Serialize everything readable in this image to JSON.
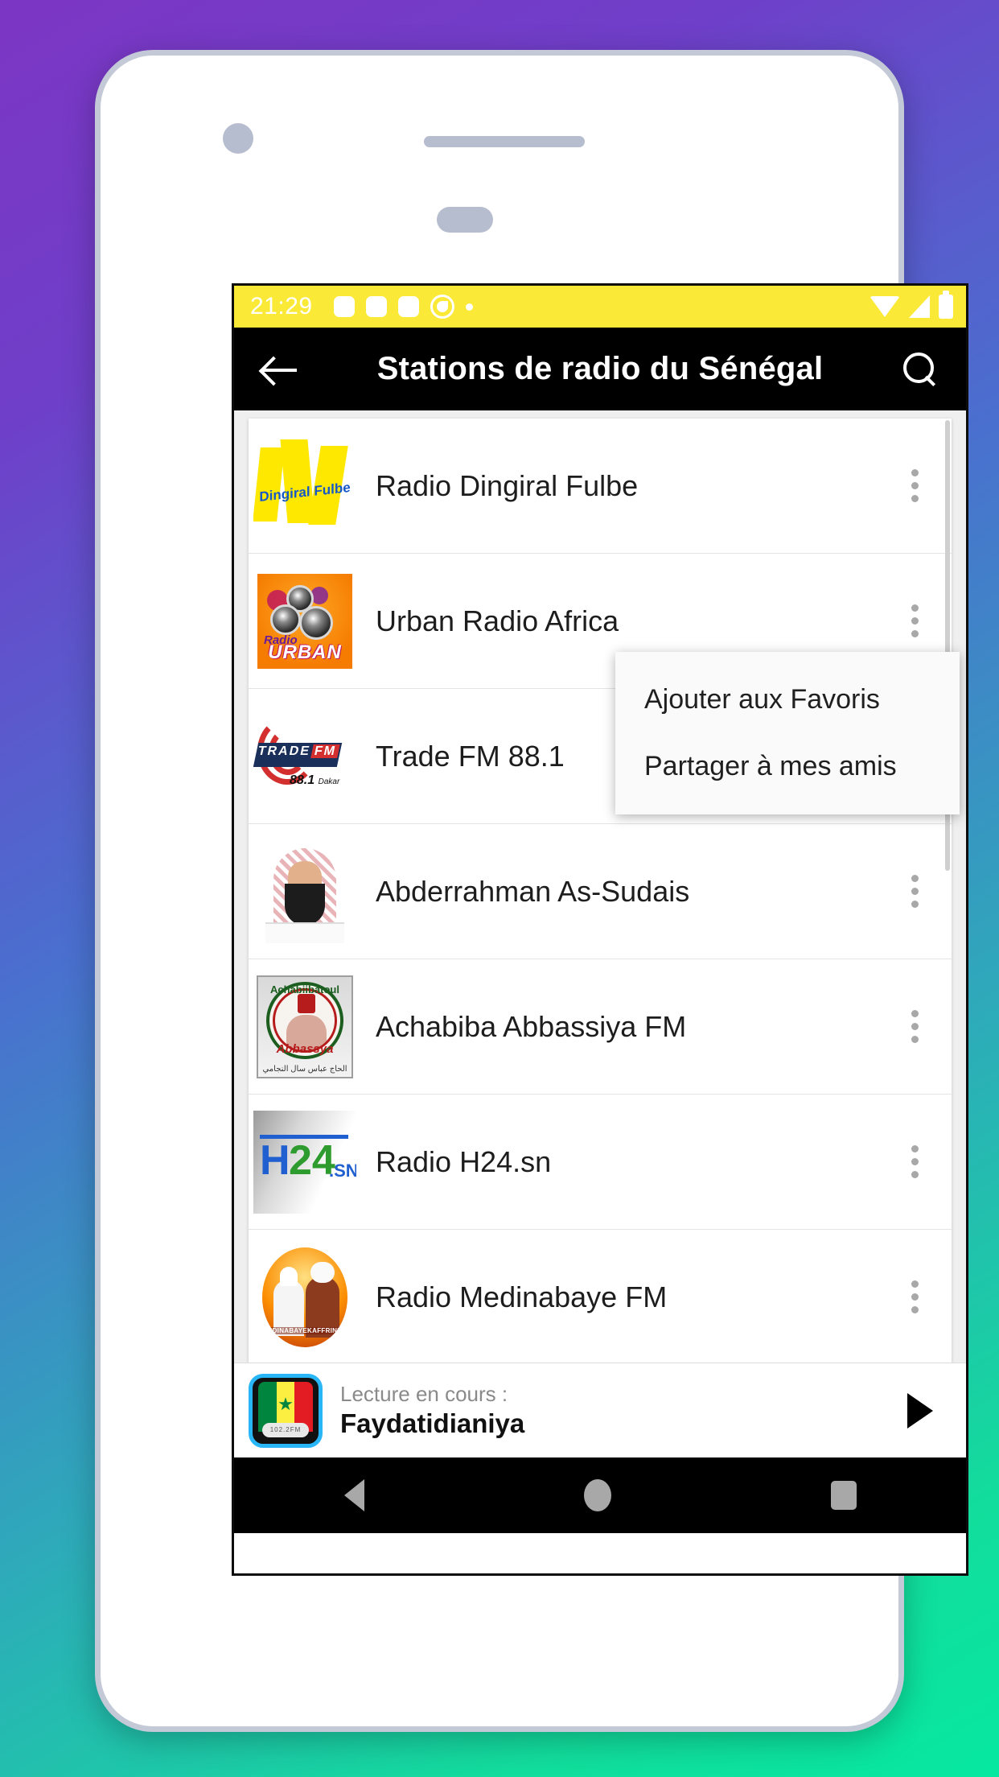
{
  "device": {
    "status_bar": {
      "time": "21:29",
      "left_icons": [
        "notification-square",
        "notification-square",
        "notification-square",
        "sync-ring-icon",
        "notification-dot"
      ],
      "right_icons": [
        "wifi-icon",
        "cell-signal-icon",
        "battery-icon"
      ],
      "background_color": "#fbe937"
    },
    "nav_bar": {
      "back": "nav-back-icon",
      "home": "nav-home-icon",
      "recents": "nav-recents-icon"
    }
  },
  "app_bar": {
    "back_icon": "arrow-left-icon",
    "title": "Stations de radio du Sénégal",
    "search_icon": "search-icon",
    "background_color": "#000000"
  },
  "stations": [
    {
      "name": "Radio Dingiral Fulbe",
      "logo": "dingiral-fulbe-logo",
      "logo_text": "Dingiral Fulbe"
    },
    {
      "name": "Urban Radio Africa",
      "logo": "urban-radio-logo",
      "logo_text_top": "Radio",
      "logo_text_bottom": "URBAN"
    },
    {
      "name": "Trade FM 88.1",
      "logo": "trade-fm-logo",
      "logo_text": "TRADE",
      "logo_text_accent": "FM",
      "logo_sub": "88.1",
      "logo_sub_small": "Dakar"
    },
    {
      "name": "Abderrahman As-Sudais",
      "logo": "abderrahman-as-sudais-photo"
    },
    {
      "name": "Achabiba Abbassiya FM",
      "logo": "achabiba-abbassiya-logo",
      "logo_top": "Achabiibatoul",
      "logo_bottom": "Abbassya",
      "logo_arabic": "الحاج عباس سال النجامي"
    },
    {
      "name": "Radio H24.sn",
      "logo": "h24-sn-logo",
      "logo_h": "H",
      "logo_24": "24",
      "logo_sn": ".SN"
    },
    {
      "name": "Radio Medinabaye FM",
      "logo": "medinabaye-logo",
      "logo_url": "MEDINABAYEKAFFRINE.NET"
    }
  ],
  "row_menu_icon": "more-vertical-icon",
  "context_menu": {
    "items": [
      {
        "label": "Ajouter aux Favoris"
      },
      {
        "label": "Partager à mes amis"
      }
    ]
  },
  "now_playing": {
    "label": "Lecture en cours :",
    "title": "Faydatidianiya",
    "artwork": "senegal-flag-radio-icon",
    "artwork_dial_text": "102.2FM",
    "play_icon": "play-icon"
  },
  "theme": {
    "background_gradient_start": "#7c36c4",
    "background_gradient_end": "#06e8a0",
    "status_bar_yellow": "#fbe937",
    "app_bar_black": "#000000",
    "accent_blue": "#29b6f6"
  }
}
